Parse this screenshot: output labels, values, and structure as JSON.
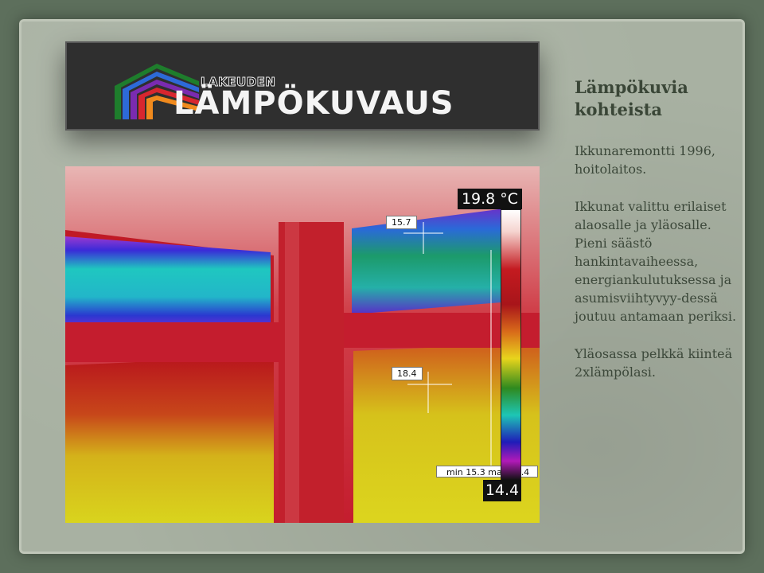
{
  "logo": {
    "small": "LAKEUDEN",
    "big": "LÄMPÖKUVAUS"
  },
  "thermal": {
    "scale_max": "19.8 °C",
    "scale_min": "14.4",
    "minmax": "min 15.3 max 19.4",
    "spot_upper": "15.7",
    "spot_lower": "18.4"
  },
  "panel": {
    "title": "Lämpökuvia kohteista",
    "para1": "Ikkunaremontti 1996, hoitolaitos.",
    "para2": "Ikkunat valittu erilaiset alaosalle ja yläosalle. Pieni säästö hankintavaiheessa, energiankulutuksessa ja asumisviihtyvyy-dessä joutuu antamaan periksi.",
    "para3": "Yläosassa pelkkä kiinteä 2xlämpölasi."
  }
}
